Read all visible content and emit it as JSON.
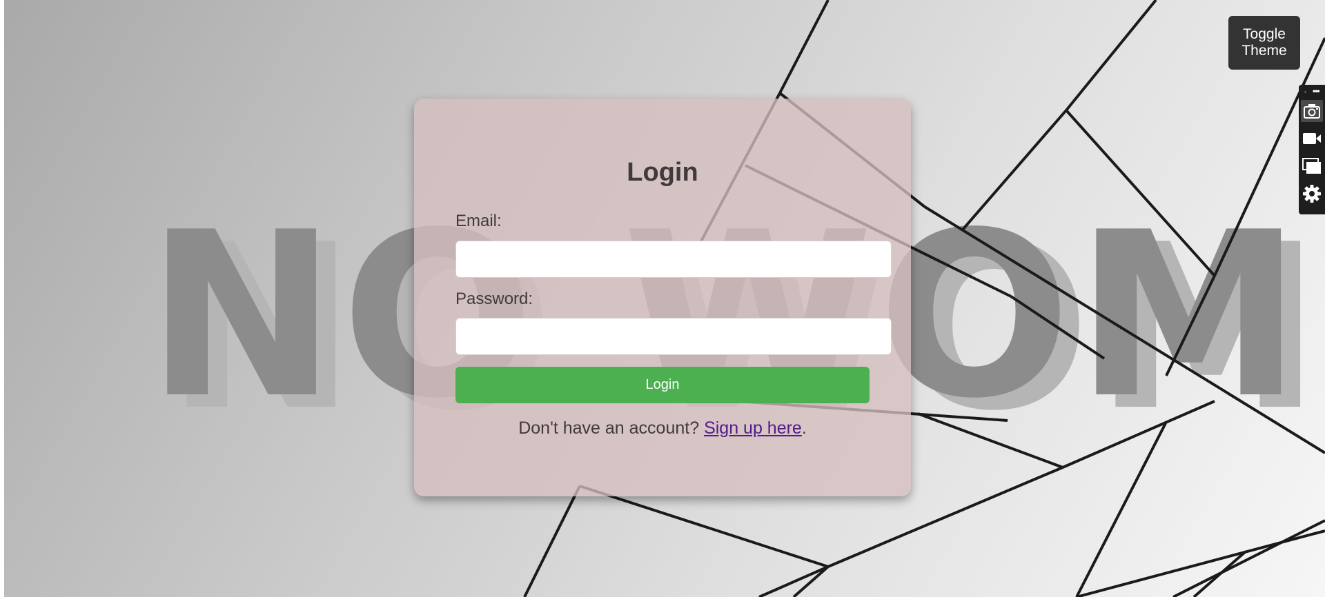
{
  "background": {
    "watermark_text": "NO WOME"
  },
  "toggle_theme": {
    "label": "Toggle Theme"
  },
  "side_toolbar": {
    "icons": [
      "camera-icon",
      "video-camera-icon",
      "windows-icon",
      "gear-icon"
    ]
  },
  "login_form": {
    "title": "Login",
    "email_label": "Email:",
    "email_value": "",
    "password_label": "Password:",
    "password_value": "",
    "submit_label": "Login",
    "signup_prompt": "Don't have an account?",
    "signup_link": "Sign up here",
    "signup_suffix": "."
  },
  "colors": {
    "card_background": "#d6bebf",
    "submit_button": "#4caf50",
    "toggle_button": "#333333",
    "link": "#551a8b",
    "text": "#3f3a3b"
  }
}
